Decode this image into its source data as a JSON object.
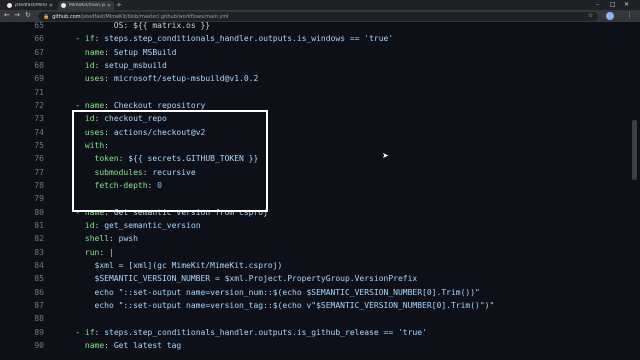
{
  "browser": {
    "tabs": [
      {
        "title": "jstedfast/MimeKit: A .NET MIME",
        "active": false
      },
      {
        "title": "MimeKit/main.yml at master · jst",
        "active": true
      }
    ],
    "new_tab": "+",
    "window_controls": {
      "minimize": "–",
      "maximize": "□",
      "close": "✕"
    },
    "url_host": "github.com",
    "url_path": "/jstedfast/MimeKit/blob/master/.github/workflows/main.yml",
    "nav": {
      "back": "←",
      "forward": "→",
      "reload": "↻"
    },
    "star": "☆",
    "menu": "⋮"
  },
  "code": {
    "lines": [
      {
        "n": "65",
        "segs": [
          [
            "p",
            "            OS: ${{ matrix.os }}"
          ]
        ]
      },
      {
        "n": "66",
        "segs": [
          [
            "p",
            "    "
          ],
          [
            "p",
            "- "
          ],
          [
            "k",
            "if"
          ],
          [
            "p",
            ": "
          ],
          [
            "s",
            "steps.step_conditionals_handler.outputs.is_windows == 'true'"
          ]
        ]
      },
      {
        "n": "67",
        "segs": [
          [
            "p",
            "      "
          ],
          [
            "k",
            "name"
          ],
          [
            "p",
            ": "
          ],
          [
            "s",
            "Setup MSBuild"
          ]
        ]
      },
      {
        "n": "68",
        "segs": [
          [
            "p",
            "      "
          ],
          [
            "k",
            "id"
          ],
          [
            "p",
            ": "
          ],
          [
            "s",
            "setup_msbuild"
          ]
        ]
      },
      {
        "n": "69",
        "segs": [
          [
            "p",
            "      "
          ],
          [
            "k",
            "uses"
          ],
          [
            "p",
            ": "
          ],
          [
            "s",
            "microsoft/setup-msbuild@v1.0.2"
          ]
        ]
      },
      {
        "n": "71",
        "segs": []
      },
      {
        "n": "72",
        "segs": [
          [
            "p",
            "    - "
          ],
          [
            "k",
            "name"
          ],
          [
            "p",
            ": "
          ],
          [
            "s",
            "Checkout repository"
          ]
        ]
      },
      {
        "n": "73",
        "segs": [
          [
            "p",
            "      "
          ],
          [
            "k",
            "id"
          ],
          [
            "p",
            ": "
          ],
          [
            "s",
            "checkout_repo"
          ]
        ]
      },
      {
        "n": "74",
        "segs": [
          [
            "p",
            "      "
          ],
          [
            "k",
            "uses"
          ],
          [
            "p",
            ": "
          ],
          [
            "s",
            "actions/checkout@v2"
          ]
        ]
      },
      {
        "n": "75",
        "segs": [
          [
            "p",
            "      "
          ],
          [
            "k",
            "with"
          ],
          [
            "p",
            ":"
          ]
        ]
      },
      {
        "n": "76",
        "segs": [
          [
            "p",
            "        "
          ],
          [
            "k",
            "token"
          ],
          [
            "p",
            ": "
          ],
          [
            "s",
            "${{ secrets.GITHUB_TOKEN }}"
          ]
        ]
      },
      {
        "n": "77",
        "segs": [
          [
            "p",
            "        "
          ],
          [
            "k",
            "submodules"
          ],
          [
            "p",
            ": "
          ],
          [
            "s",
            "recursive"
          ]
        ]
      },
      {
        "n": "78",
        "segs": [
          [
            "p",
            "        "
          ],
          [
            "k",
            "fetch-depth"
          ],
          [
            "p",
            ": "
          ],
          [
            "n",
            "0"
          ]
        ]
      },
      {
        "n": "79",
        "segs": []
      },
      {
        "n": "80",
        "segs": [
          [
            "p",
            "    - "
          ],
          [
            "k",
            "name"
          ],
          [
            "p",
            ": "
          ],
          [
            "s",
            "Get semantic version from csproj"
          ]
        ]
      },
      {
        "n": "81",
        "segs": [
          [
            "p",
            "      "
          ],
          [
            "k",
            "id"
          ],
          [
            "p",
            ": "
          ],
          [
            "s",
            "get_semantic_version"
          ]
        ]
      },
      {
        "n": "82",
        "segs": [
          [
            "p",
            "      "
          ],
          [
            "k",
            "shell"
          ],
          [
            "p",
            ": "
          ],
          [
            "s",
            "pwsh"
          ]
        ]
      },
      {
        "n": "83",
        "segs": [
          [
            "p",
            "      "
          ],
          [
            "k",
            "run"
          ],
          [
            "p",
            ": |"
          ]
        ]
      },
      {
        "n": "84",
        "segs": [
          [
            "s",
            "        $xml = [xml](gc MimeKit/MimeKit.csproj)"
          ]
        ]
      },
      {
        "n": "85",
        "segs": [
          [
            "s",
            "        $SEMANTIC_VERSION_NUMBER = $xml.Project.PropertyGroup.VersionPrefix"
          ]
        ]
      },
      {
        "n": "86",
        "segs": [
          [
            "s",
            "        echo \"::set-output name=version_num::$(echo $SEMANTIC_VERSION_NUMBER[0].Trim())\""
          ]
        ]
      },
      {
        "n": "87",
        "segs": [
          [
            "s",
            "        echo \"::set-output name=version_tag::$(echo v\"$SEMANTIC_VERSION_NUMBER[0].Trim()\")\""
          ]
        ]
      },
      {
        "n": "88",
        "segs": []
      },
      {
        "n": "89",
        "segs": [
          [
            "p",
            "    - "
          ],
          [
            "k",
            "if"
          ],
          [
            "p",
            ": "
          ],
          [
            "s",
            "steps.step_conditionals_handler.outputs.is_github_release == 'true'"
          ]
        ]
      },
      {
        "n": "90",
        "segs": [
          [
            "p",
            "      "
          ],
          [
            "k",
            "name"
          ],
          [
            "p",
            ": "
          ],
          [
            "s",
            "Get latest tag"
          ]
        ]
      }
    ]
  },
  "colors": {
    "key": "#7ee787",
    "string": "#a5d6ff",
    "plain": "#c9d1d9",
    "number": "#79c0ff",
    "highlight_box": "#ffffff"
  }
}
